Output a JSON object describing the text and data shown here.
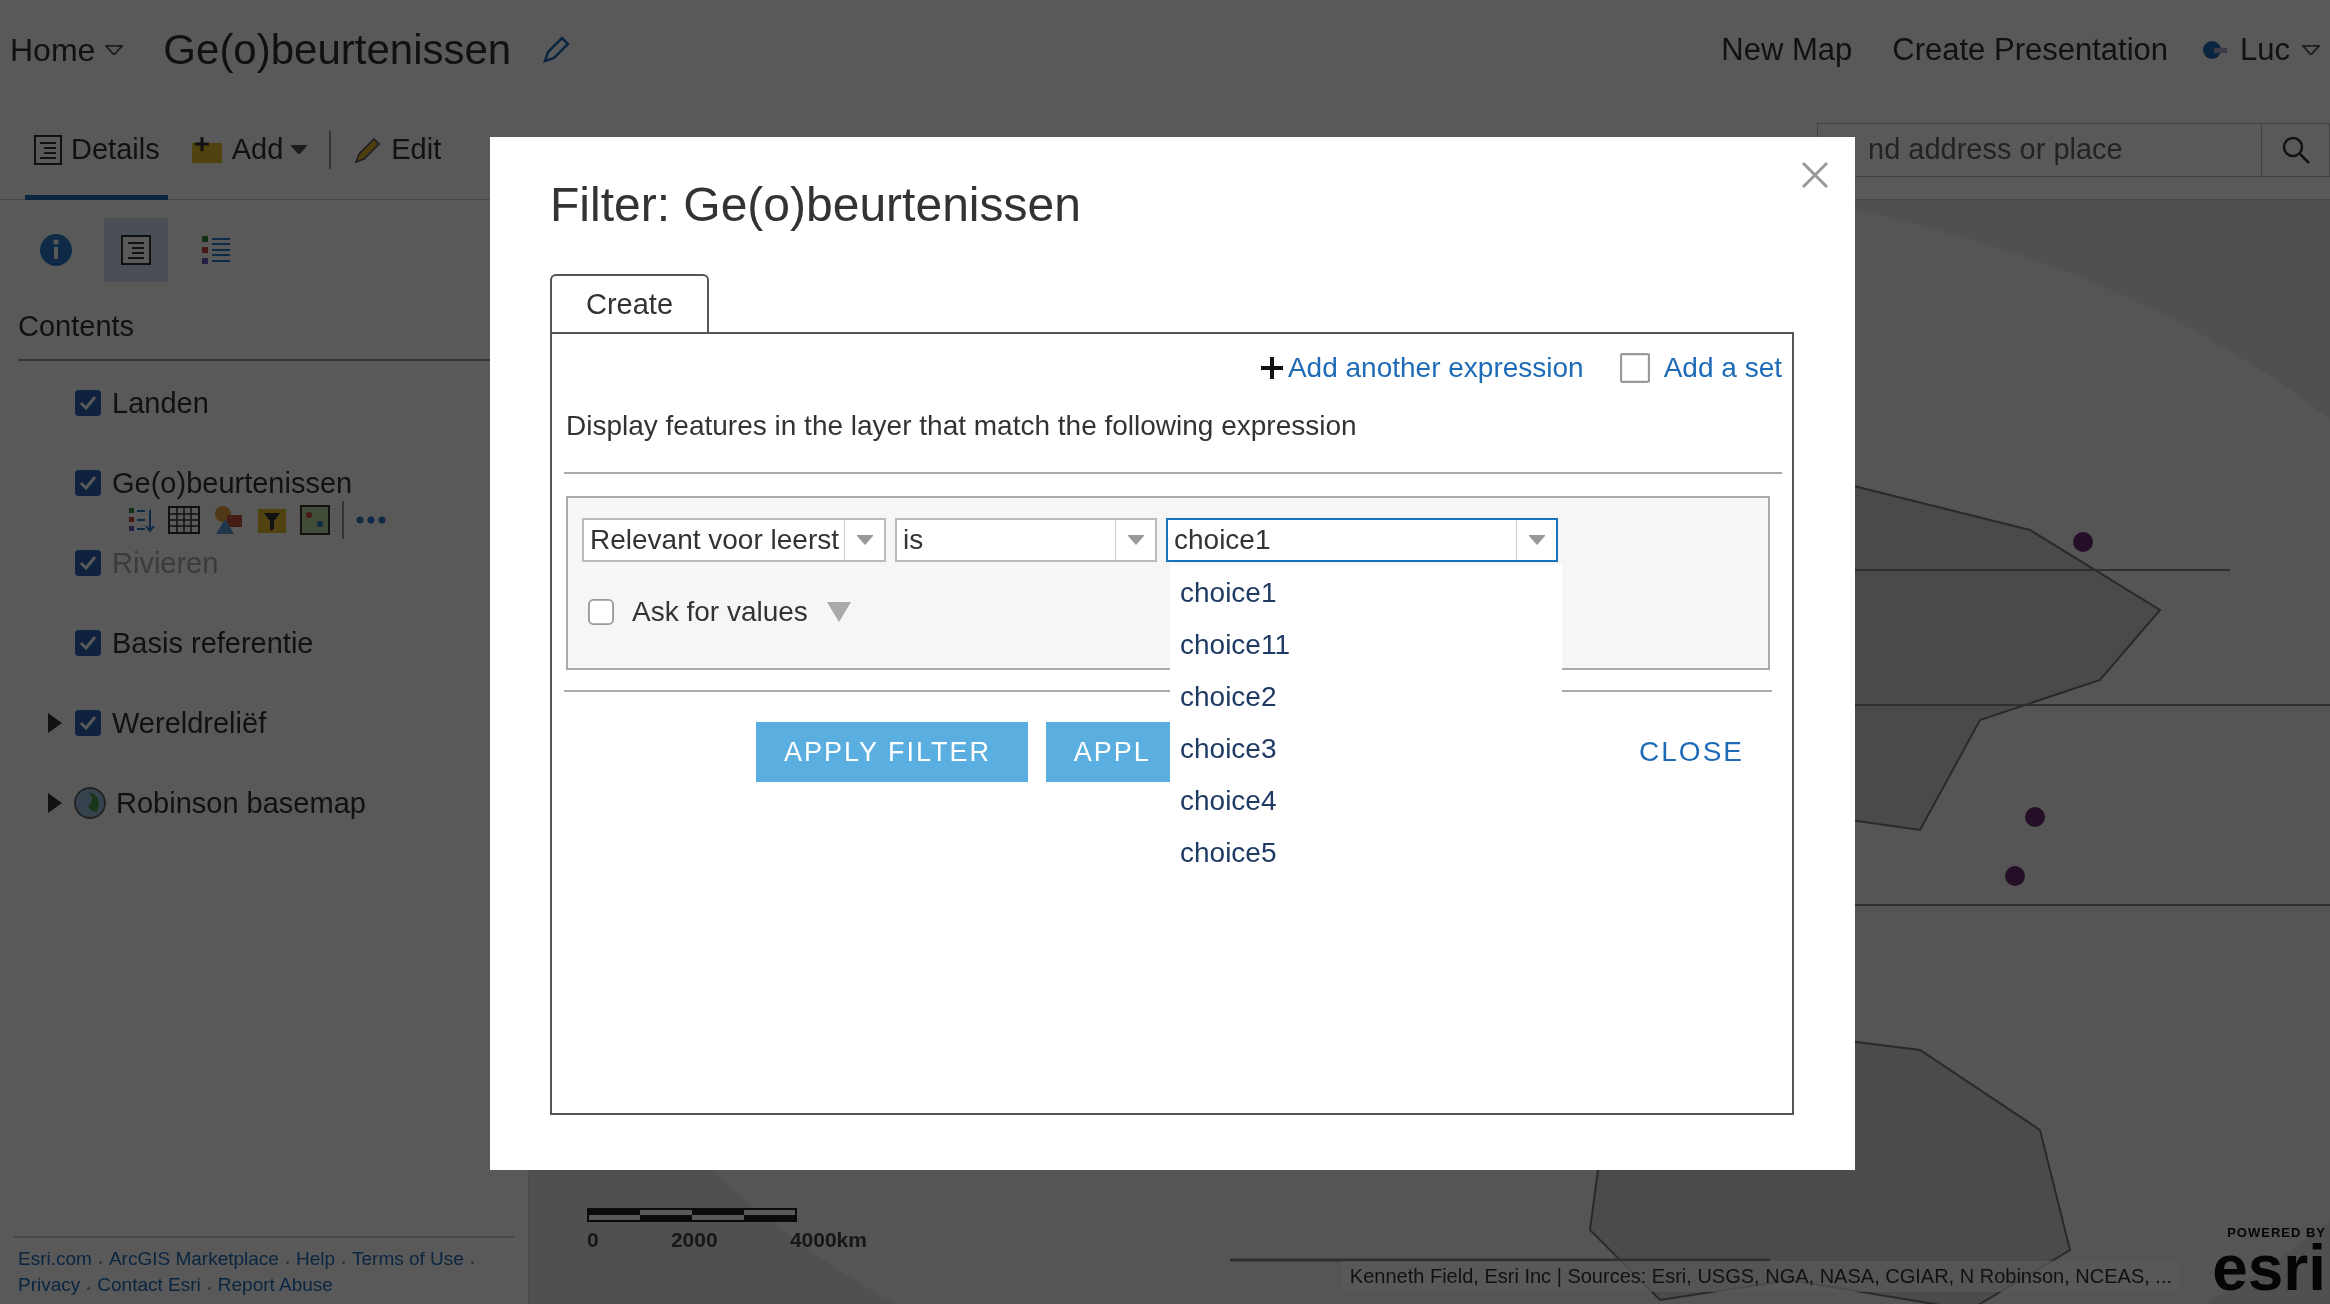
{
  "header": {
    "home": "Home",
    "map_title": "Ge(o)beurtenissen",
    "links": [
      "New Map",
      "Create Presentation"
    ],
    "user": "Luc"
  },
  "toolbar": {
    "tabs": [
      {
        "label": "Details",
        "selected": true,
        "menu": false
      },
      {
        "label": "Add",
        "selected": false,
        "menu": true
      },
      {
        "label": "Edit",
        "selected": false,
        "menu": false
      }
    ]
  },
  "search": {
    "placeholder": "nd address or place"
  },
  "sidebar": {
    "panel_tabs": [
      {
        "kind": "info",
        "selected": false
      },
      {
        "kind": "details",
        "selected": true
      },
      {
        "kind": "legend",
        "selected": false
      }
    ],
    "heading": "Contents",
    "layers": [
      {
        "name": "Landen",
        "kind": "checkbox",
        "checked": true,
        "dimmed": false,
        "expandable": false,
        "tools": false
      },
      {
        "name": "Ge(o)beurtenissen",
        "kind": "checkbox",
        "checked": true,
        "dimmed": false,
        "expandable": false,
        "tools": true
      },
      {
        "name": "Rivieren",
        "kind": "checkbox",
        "checked": true,
        "dimmed": true,
        "expandable": false,
        "tools": false
      },
      {
        "name": "Basis referentie",
        "kind": "checkbox",
        "checked": true,
        "dimmed": false,
        "expandable": false,
        "tools": false
      },
      {
        "name": "Wereldreliëf",
        "kind": "checkbox",
        "checked": true,
        "dimmed": false,
        "expandable": true,
        "tools": false
      },
      {
        "name": "Robinson basemap",
        "kind": "basemap",
        "dimmed": false,
        "expandable": true,
        "tools": false
      }
    ],
    "footer_links": [
      [
        "Esri.com",
        "ArcGIS Marketplace",
        "Help",
        "Terms of Use"
      ],
      [
        "Privacy",
        "Contact Esri",
        "Report Abuse"
      ]
    ]
  },
  "map": {
    "kind": "picture",
    "scale_labels": [
      "0",
      "2000",
      "4000km"
    ],
    "attribution": "Kenneth Field, Esri Inc | Sources: Esri, USGS, NGA, NASA, CGIAR, N Robinson, NCEAS, ...",
    "logo_caption": "POWERED BY",
    "logo": "esri"
  },
  "dialog": {
    "title": "Filter: Ge(o)beurtenissen",
    "tabs": [
      {
        "label": "Create",
        "selected": true
      }
    ],
    "add_expression": "Add another expression",
    "add_set": {
      "label": "Add a set",
      "checked": false
    },
    "description": "Display features in the layer that match the following expression",
    "expression": {
      "field": "Relevant voor leerst",
      "operator": "is",
      "value": "choice1",
      "ask_for_values": {
        "label": "Ask for values",
        "checked": false
      }
    },
    "dropdown": {
      "options": [
        "choice1",
        "choice11",
        "choice2",
        "choice3",
        "choice4",
        "choice5"
      ]
    },
    "buttons": [
      {
        "label": "APPLY FILTER",
        "kind": "primary"
      },
      {
        "label": "APPL",
        "kind": "primary"
      },
      {
        "label": "CLOSE",
        "kind": "link"
      }
    ]
  }
}
